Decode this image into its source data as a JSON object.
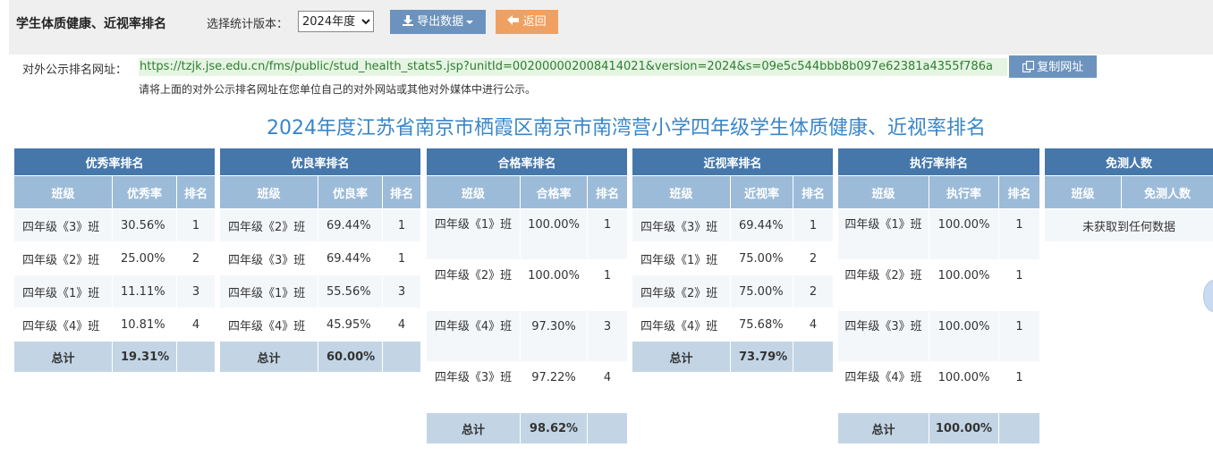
{
  "header": {
    "title": "学生体质健康、近视率排名",
    "version_label": "选择统计版本：",
    "version_selected": "2024年度",
    "export_label": "导出数据",
    "back_label": "返回"
  },
  "public_url": {
    "label": "对外公示排名网址：",
    "url": "https://tzjk.jse.edu.cn/fms/public/stud_health_stats5.jsp?unitId=002000002008414021&version=2024&s=09e5c544bbb8b097e62381a4355f786a",
    "copy_label": "复制网址",
    "hint": "请将上面的对外公示排名网址在您单位自己的对外网站或其他对外媒体中进行公示。"
  },
  "report_title": "2024年度江苏省南京市栖霞区南京市南湾营小学四年级学生体质健康、近视率排名",
  "icons": {
    "export": "download-icon",
    "back": "reply-arrow-icon",
    "copy": "copy-icon"
  },
  "colors": {
    "caption_bg": "#4577aa",
    "header_bg": "#9cbbd8",
    "total_bg": "#c3d5e5",
    "title": "#3a86c8",
    "export_btn": "#6c93bd",
    "back_btn": "#f0a061"
  },
  "tables": {
    "excellent": {
      "caption": "优秀率排名",
      "columns": [
        "班级",
        "优秀率",
        "排名"
      ],
      "rows": [
        [
          "四年级《3》班",
          "30.56%",
          "1"
        ],
        [
          "四年级《2》班",
          "25.00%",
          "2"
        ],
        [
          "四年级《1》班",
          "11.11%",
          "3"
        ],
        [
          "四年级《4》班",
          "10.81%",
          "4"
        ]
      ],
      "total_label": "总计",
      "total_value": "19.31%"
    },
    "good": {
      "caption": "优良率排名",
      "columns": [
        "班级",
        "优良率",
        "排名"
      ],
      "rows": [
        [
          "四年级《2》班",
          "69.44%",
          "1"
        ],
        [
          "四年级《3》班",
          "69.44%",
          "1"
        ],
        [
          "四年级《1》班",
          "55.56%",
          "3"
        ],
        [
          "四年级《4》班",
          "45.95%",
          "4"
        ]
      ],
      "total_label": "总计",
      "total_value": "60.00%"
    },
    "pass": {
      "caption": "合格率排名",
      "columns": [
        "班级",
        "合格率",
        "排名"
      ],
      "rows": [
        [
          "四年级《1》班",
          "100.00%",
          "1"
        ],
        [
          "四年级《2》班",
          "100.00%",
          "1"
        ],
        [
          "四年级《4》班",
          "97.30%",
          "3"
        ],
        [
          "四年级《3》班",
          "97.22%",
          "4"
        ]
      ],
      "total_label": "总计",
      "total_value": "98.62%"
    },
    "myopia": {
      "caption": "近视率排名",
      "columns": [
        "班级",
        "近视率",
        "排名"
      ],
      "rows": [
        [
          "四年级《3》班",
          "69.44%",
          "1"
        ],
        [
          "四年级《1》班",
          "75.00%",
          "2"
        ],
        [
          "四年级《2》班",
          "75.00%",
          "2"
        ],
        [
          "四年级《4》班",
          "75.68%",
          "4"
        ]
      ],
      "total_label": "总计",
      "total_value": "73.79%"
    },
    "execution": {
      "caption": "执行率排名",
      "columns": [
        "班级",
        "执行率",
        "排名"
      ],
      "rows": [
        [
          "四年级《1》班",
          "100.00%",
          "1"
        ],
        [
          "四年级《2》班",
          "100.00%",
          "1"
        ],
        [
          "四年级《3》班",
          "100.00%",
          "1"
        ],
        [
          "四年级《4》班",
          "100.00%",
          "1"
        ]
      ],
      "total_label": "总计",
      "total_value": "100.00%"
    },
    "exempt": {
      "caption": "免测人数",
      "columns": [
        "班级",
        "免测人数"
      ],
      "empty_text": "未获取到任何数据"
    }
  }
}
